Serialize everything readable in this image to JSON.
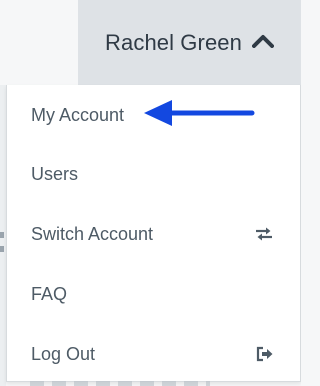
{
  "user_menu": {
    "user_name": "Rachel Green",
    "toggle_icon": "chevron-up-icon",
    "items": [
      {
        "label": "My Account",
        "icon": ""
      },
      {
        "label": "Users",
        "icon": ""
      },
      {
        "label": "Switch Account",
        "icon": "switch-arrows-icon"
      },
      {
        "label": "FAQ",
        "icon": ""
      },
      {
        "label": "Log Out",
        "icon": "logout-icon"
      }
    ]
  },
  "annotation": {
    "arrow_color": "#1348e0",
    "points_to": "My Account"
  },
  "colors": {
    "trigger_bg": "#dee2e6",
    "menu_text": "#4e5b66",
    "user_text": "#2f3a45"
  }
}
